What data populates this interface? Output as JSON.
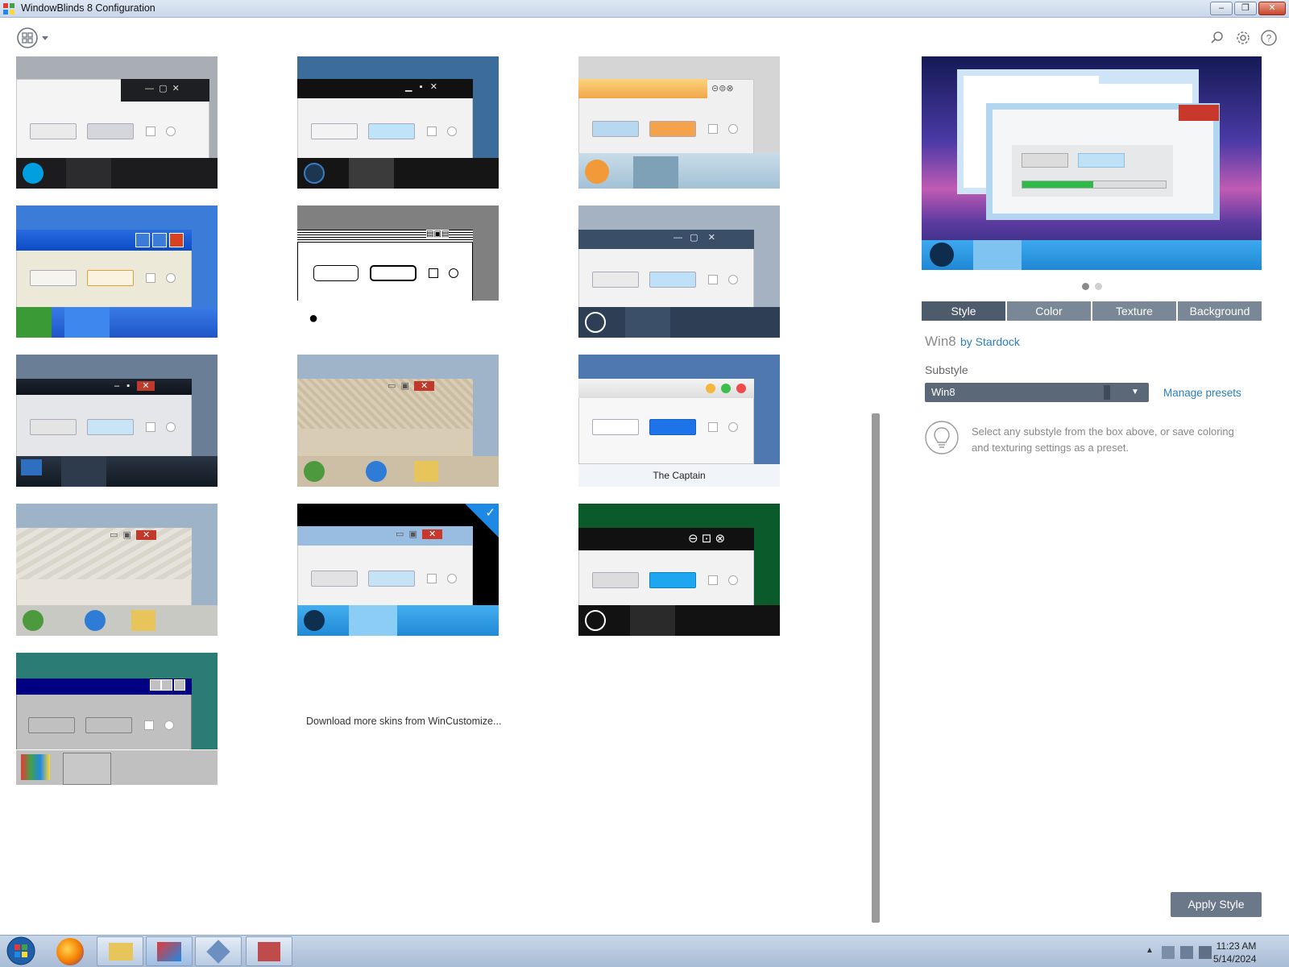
{
  "window": {
    "title": "WindowBlinds 8 Configuration",
    "controls": [
      "–",
      "❐",
      "✕"
    ]
  },
  "skins": [
    {
      "id": "skin-1"
    },
    {
      "id": "skin-2"
    },
    {
      "id": "skin-3"
    },
    {
      "id": "skin-4"
    },
    {
      "id": "skin-5"
    },
    {
      "id": "skin-6"
    },
    {
      "id": "skin-7"
    },
    {
      "id": "skin-8"
    },
    {
      "id": "skin-9",
      "caption": "The Captain"
    },
    {
      "id": "skin-10"
    },
    {
      "id": "skin-11",
      "selected": true
    },
    {
      "id": "skin-12"
    },
    {
      "id": "skin-13"
    }
  ],
  "download_link": "Download more skins from WinCustomize...",
  "panel": {
    "tabs": [
      "Style",
      "Color",
      "Texture",
      "Background"
    ],
    "active_tab": "Style",
    "skin_name": "Win8",
    "skin_author": "by Stardock",
    "substyle_label": "Substyle",
    "substyle_value": "Win8",
    "manage_presets": "Manage presets",
    "hint": "Select any substyle from the box above, or save coloring and texturing settings as a preset.",
    "apply_button": "Apply Style",
    "pager_active": 1,
    "pager_count": 2
  },
  "os_taskbar": {
    "time": "11:23 AM",
    "date": "5/14/2024"
  },
  "colors": {
    "accent": "#2a7fc0",
    "tab_active": "#4e5b6c",
    "tab_inactive": "#7a8796",
    "selected_marker": "#1e88e5"
  }
}
